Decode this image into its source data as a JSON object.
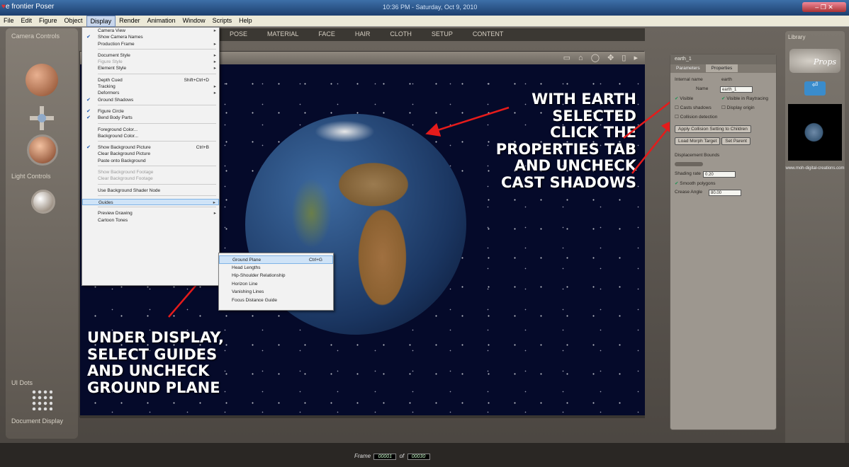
{
  "window": {
    "app_title": "e frontier Poser",
    "clock": "10:36 PM - Saturday, Oct 9, 2010"
  },
  "menubar": [
    "File",
    "Edit",
    "Figure",
    "Object",
    "Display",
    "Render",
    "Animation",
    "Window",
    "Scripts",
    "Help"
  ],
  "room_tabs": [
    "POSE",
    "MATERIAL",
    "FACE",
    "HAIR",
    "CLOTH",
    "SETUP",
    "CONTENT"
  ],
  "left_panel": {
    "camera_label": "Camera Controls",
    "light_label": "Light Controls",
    "ui_dots_label": "UI Dots",
    "doc_display_label": "Document Display"
  },
  "display_menu": [
    {
      "label": "Camera View",
      "submenu": true
    },
    {
      "label": "Show Camera Names",
      "checked": true
    },
    {
      "label": "Production Frame",
      "submenu": true
    },
    {
      "sep": true
    },
    {
      "label": "Document Style",
      "submenu": true
    },
    {
      "label": "Figure Style",
      "submenu": true,
      "disabled": true
    },
    {
      "label": "Element Style",
      "submenu": true
    },
    {
      "sep": true
    },
    {
      "label": "Depth Cued",
      "shortcut": "Shift+Ctrl+D"
    },
    {
      "label": "Tracking",
      "submenu": true
    },
    {
      "label": "Deformers",
      "submenu": true
    },
    {
      "label": "Ground Shadows",
      "checked": true
    },
    {
      "sep": true
    },
    {
      "label": "Figure Circle",
      "checked": true
    },
    {
      "label": "Bend Body Parts",
      "checked": true
    },
    {
      "sep": true
    },
    {
      "label": "Foreground Color..."
    },
    {
      "label": "Background Color..."
    },
    {
      "sep": true
    },
    {
      "label": "Show Background Picture",
      "checked": true,
      "shortcut": "Ctrl+B"
    },
    {
      "label": "Clear Background Picture"
    },
    {
      "label": "Paste onto Background"
    },
    {
      "sep": true
    },
    {
      "label": "Show Background Footage",
      "disabled": true
    },
    {
      "label": "Clear Background Footage",
      "disabled": true
    },
    {
      "sep": true
    },
    {
      "label": "Use Background Shader Node"
    },
    {
      "sep": true
    },
    {
      "label": "Guides",
      "submenu": true,
      "highlighted": true
    },
    {
      "sep": true
    },
    {
      "label": "Preview Drawing",
      "submenu": true
    },
    {
      "label": "Cartoon Tones"
    }
  ],
  "guides_menu": [
    {
      "label": "Ground Plane",
      "shortcut": "Ctrl+G",
      "highlighted": true
    },
    {
      "label": "Head Lengths"
    },
    {
      "label": "Hip-Shoulder Relationship"
    },
    {
      "label": "Horizon Line"
    },
    {
      "label": "Vanishing Lines"
    },
    {
      "label": "Focus Distance Guide"
    }
  ],
  "annotations": {
    "left": [
      "UNDER DISPLAY,",
      "SELECT GUIDES",
      "AND UNCHECK",
      "GROUND PLANE"
    ],
    "right": [
      "WITH EARTH",
      "SELECTED",
      "CLICK THE",
      "PROPERTIES TAB",
      "AND UNCHECK",
      "CAST SHADOWS"
    ]
  },
  "properties_panel": {
    "header": "earth_1",
    "tabs": [
      "Parameters",
      "Properties"
    ],
    "internal_name_label": "Internal name",
    "internal_name": "earth",
    "name_label": "Name",
    "name_value": "earth_1",
    "visible": "Visible",
    "visible_raytracing": "Visible in Raytracing",
    "casts_shadows": "Casts shadows",
    "display_origin": "Display origin",
    "collision_detection": "Collision detection",
    "apply_collision": "Apply Collision Setting to Children",
    "load_morph": "Load Morph Target",
    "set_parent": "Set Parent",
    "displacement_bounds": "Displacement Bounds",
    "shading_rate_label": "Shading rate",
    "shading_rate": "0.20",
    "smooth_polygons": "Smooth polygons",
    "crease_angle_label": "Crease Angle",
    "crease_angle": "80.00"
  },
  "library": {
    "tab": "Library",
    "props": "Props",
    "folder_label": "Up",
    "thumb_url": "www.moh-digital-creations.com"
  },
  "timeline": {
    "frame_label": "Frame",
    "current": "00001",
    "of": "of",
    "total": "00030"
  }
}
